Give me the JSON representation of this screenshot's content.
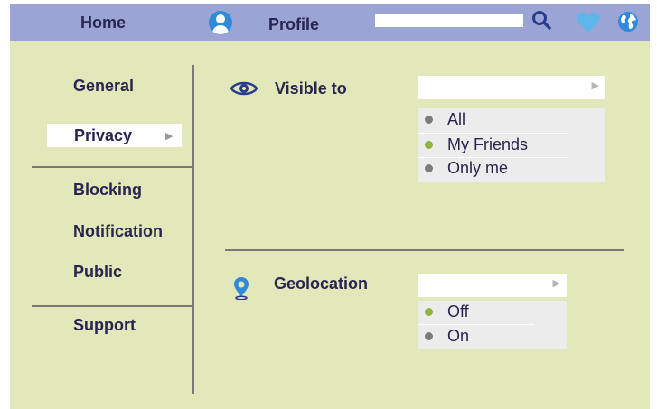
{
  "topbar": {
    "home_label": "Home",
    "profile_label": "Profile",
    "search_value": ""
  },
  "sidebar": {
    "items": [
      {
        "label": "General"
      },
      {
        "label": "Privacy",
        "active": true
      },
      {
        "label": "Blocking"
      },
      {
        "label": "Notification"
      },
      {
        "label": "Public"
      },
      {
        "label": "Support"
      }
    ]
  },
  "privacy": {
    "visible_to": {
      "title": "Visible to",
      "options": [
        {
          "label": "All",
          "selected": false
        },
        {
          "label": "My Friends",
          "selected": true
        },
        {
          "label": "Only me",
          "selected": false
        }
      ]
    },
    "geolocation": {
      "title": "Geolocation",
      "options": [
        {
          "label": "Off",
          "selected": true
        },
        {
          "label": "On",
          "selected": false
        }
      ]
    }
  },
  "colors": {
    "background": "#e3e8bb",
    "topbar": "#9aa5d5",
    "selected_dot": "#8fb53a",
    "unselected_dot": "#7c7c7c",
    "icon_blue": "#2f8ad9",
    "heart": "#5fb6ea"
  },
  "icons": [
    "user-avatar-icon",
    "search-icon",
    "heart-icon",
    "globe-icon",
    "eye-icon",
    "location-pin-icon",
    "chevron-right-icon"
  ]
}
